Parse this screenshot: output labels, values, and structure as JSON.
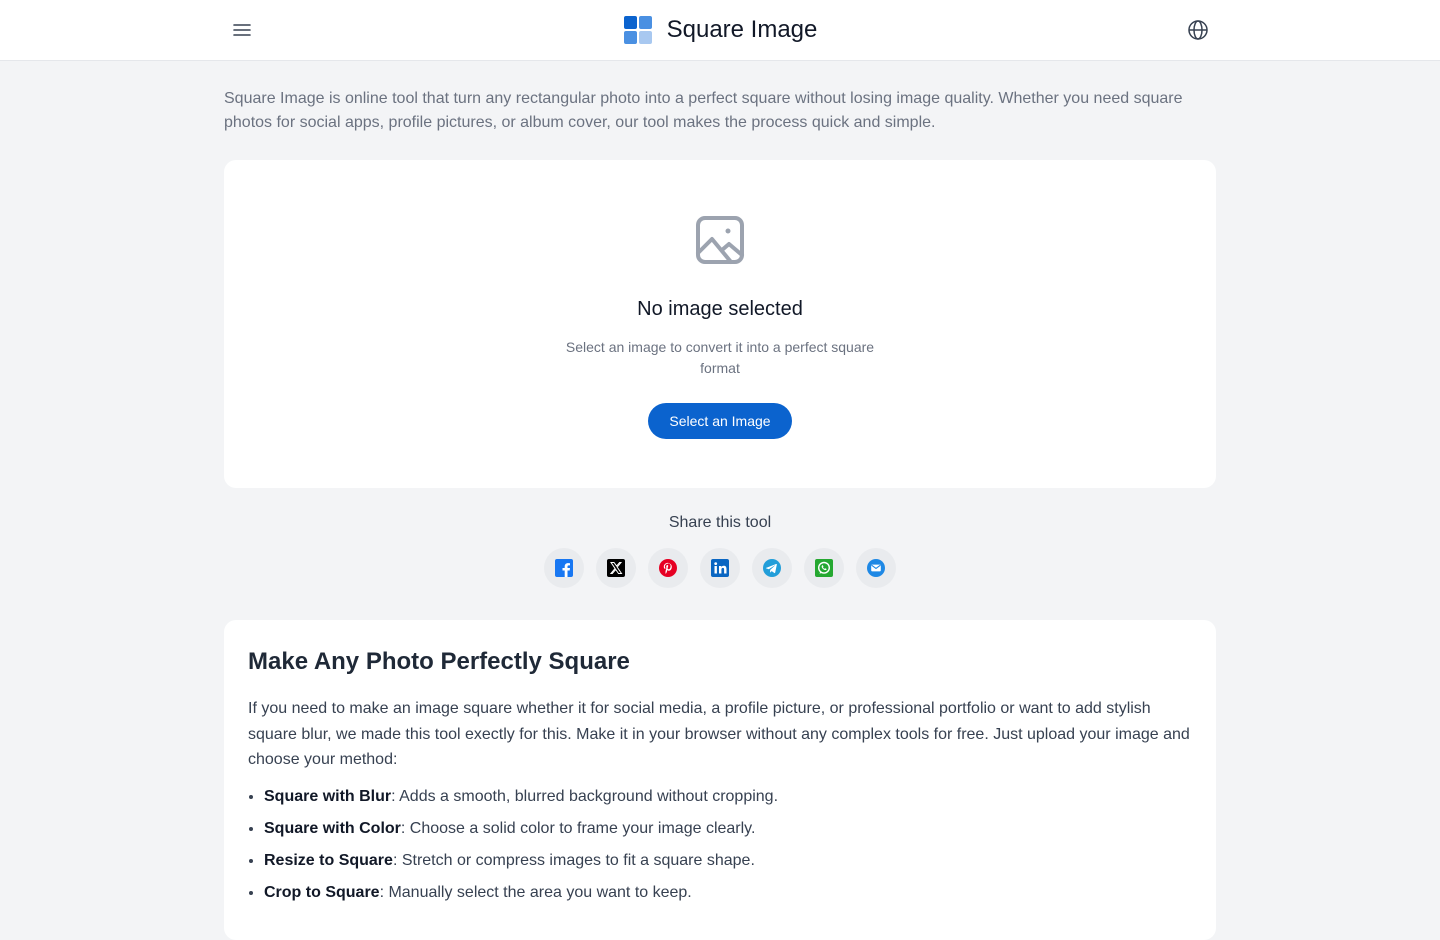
{
  "header": {
    "title": "Square Image",
    "menu_icon": "hamburger-menu-icon",
    "logo_icon": "grid-squares-logo-icon",
    "language_icon": "globe-icon"
  },
  "intro": {
    "text": "Square Image is online tool that turn any rectangular photo into a perfect square without losing image quality. Whether you need square photos for social apps, profile pictures, or album cover, our tool makes the process quick and simple."
  },
  "upload": {
    "icon": "image-placeholder-icon",
    "heading": "No image selected",
    "subtext": "Select an image to convert it into a perfect square format",
    "button_label": "Select an Image"
  },
  "share": {
    "title": "Share this tool",
    "buttons": [
      {
        "name": "facebook-icon",
        "color": "#1877f2"
      },
      {
        "name": "x-icon",
        "color": "#000000"
      },
      {
        "name": "pinterest-icon",
        "color": "#e60023"
      },
      {
        "name": "linkedin-icon",
        "color": "#0a66c2"
      },
      {
        "name": "telegram-icon",
        "color": "#229ed9"
      },
      {
        "name": "whatsapp-icon",
        "color": "#25d366"
      },
      {
        "name": "email-icon",
        "color": "#1e88e5"
      }
    ]
  },
  "info": {
    "title": "Make Any Photo Perfectly Square",
    "text": "If you need to make an image square whether it for social media, a profile picture, or professional portfolio or want to add stylish square blur, we made this tool exectly for this. Make it in your browser without any complex tools for free. Just upload your image and choose your method:",
    "methods": [
      {
        "name": "Square with Blur",
        "desc": ": Adds a smooth, blurred background without cropping."
      },
      {
        "name": "Square with Color",
        "desc": ": Choose a solid color to frame your image clearly."
      },
      {
        "name": "Resize to Square",
        "desc": ": Stretch or compress images to fit a square shape."
      },
      {
        "name": "Crop to Square",
        "desc": ": Manually select the area you want to keep."
      }
    ]
  },
  "colors": {
    "accent": "#0b63ce",
    "background": "#f3f4f6"
  }
}
